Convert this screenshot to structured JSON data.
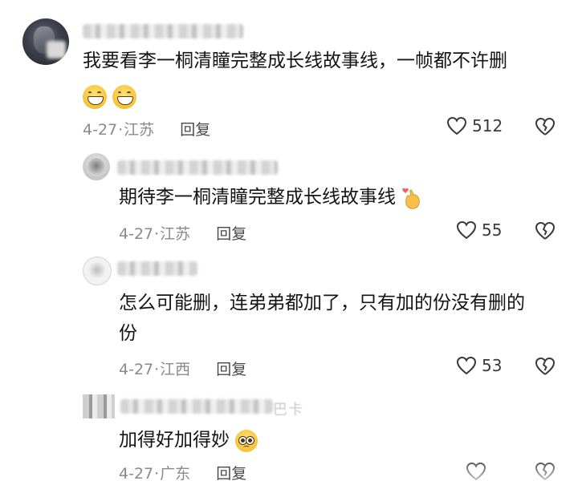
{
  "comments": [
    {
      "content": "我要看李一桐清瞳完整成长线故事线，一帧都不许删",
      "date": "4-27",
      "location": "江苏",
      "reply_label": "回复",
      "likes": "512",
      "emoji": [
        "grinning-face",
        "grinning-face"
      ]
    },
    {
      "content": "期待李一桐清瞳完整成长线故事线",
      "date": "4-27",
      "location": "江苏",
      "reply_label": "回复",
      "likes": "55",
      "emoji": [
        "hand-heart"
      ]
    },
    {
      "content_line1": "怎么可能删，连弟弟都加了，只有加的份没有删的",
      "content_line2": "份",
      "date": "4-27",
      "location": "江西",
      "reply_label": "回复",
      "likes": "53"
    },
    {
      "content": "加得好加得妙",
      "date": "4-27",
      "location": "广东",
      "reply_label": "回复",
      "name_fragment": "巴卡",
      "emoji": [
        "pleading-face"
      ]
    }
  ],
  "separator": "·",
  "icons": {
    "like": "heart-outline-icon",
    "dislike": "broken-heart-icon"
  },
  "colors": {
    "text": "#141414",
    "meta": "#8a8a8a",
    "icon": "#3a3a3a"
  }
}
